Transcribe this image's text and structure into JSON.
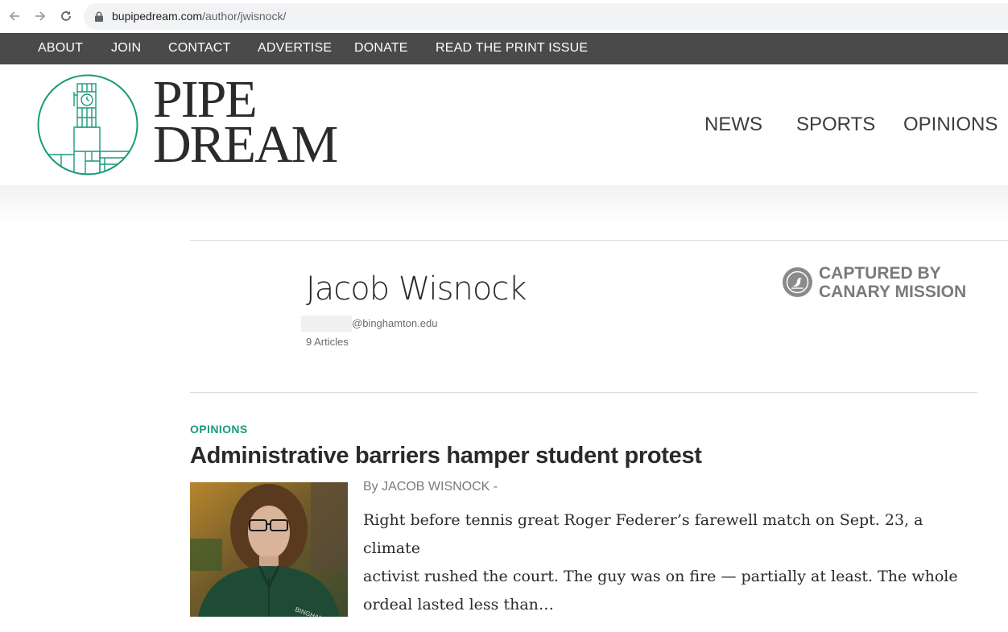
{
  "browser": {
    "url_host": "bupipedream.com",
    "url_path": "/author/jwisnock/"
  },
  "top_nav": {
    "items": [
      "ABOUT",
      "JOIN",
      "CONTACT",
      "ADVERTISE",
      "DONATE",
      "READ THE PRINT ISSUE"
    ]
  },
  "site": {
    "logo_line1": "PIPE",
    "logo_line2": "DREAM",
    "brand_color": "#1a9a7a"
  },
  "main_nav": {
    "items": [
      "NEWS",
      "SPORTS",
      "OPINIONS"
    ]
  },
  "author": {
    "name": "Jacob Wisnock",
    "email_domain": "@binghamton.edu",
    "article_count": "9 Articles"
  },
  "badge": {
    "line1": "CAPTURED BY",
    "line2": "CANARY MISSION"
  },
  "article": {
    "category": "OPINIONS",
    "title": "Administrative barriers hamper student protest",
    "byline": "By JACOB WISNOCK -",
    "excerpt_line1": "Right before tennis great Roger Federer’s farewell match on Sept. 23, a climate",
    "excerpt_line2": "activist rushed the court. The guy was on fire — partially at least. The whole",
    "excerpt_line3": "ordeal lasted less than…"
  }
}
